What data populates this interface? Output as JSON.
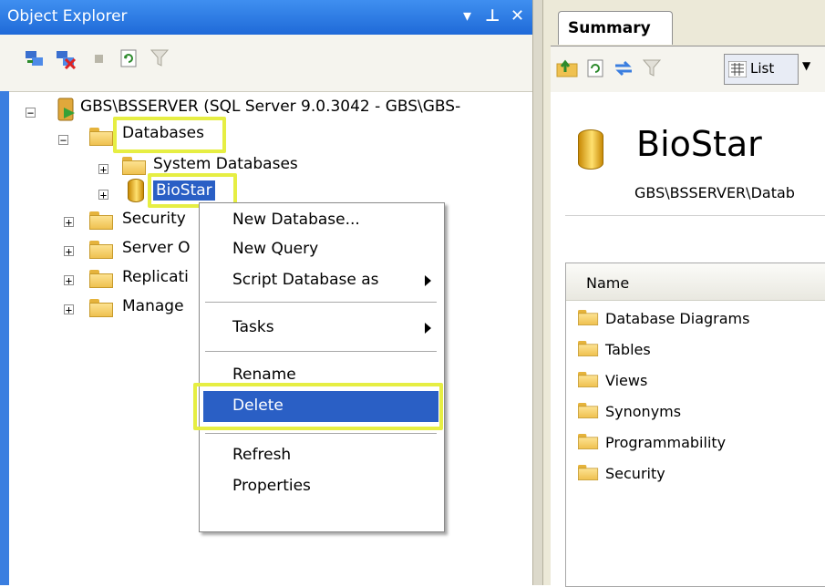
{
  "object_explorer": {
    "title": "Object Explorer",
    "controls": [
      "▾",
      "⊥",
      "✕"
    ],
    "tree": {
      "server": "GBS\\BSSERVER (SQL Server 9.0.3042 - GBS\\GBS-",
      "databases": "Databases",
      "system_databases": "System Databases",
      "biostar": "BioStar",
      "security": "Security",
      "server_objects": "Server O",
      "replication": "Replicati",
      "management": "Manage"
    }
  },
  "context_menu": {
    "items": {
      "new_database": "New Database...",
      "new_query": "New Query",
      "script_database_as": "Script Database as",
      "tasks": "Tasks",
      "rename": "Rename",
      "delete": "Delete",
      "refresh": "Refresh",
      "properties": "Properties"
    }
  },
  "summary": {
    "tab_label": "Summary",
    "view_button": "List",
    "db_title": "BioStar",
    "db_path": "GBS\\BSSERVER\\Datab",
    "list_header": "Name",
    "list_items": [
      "Database Diagrams",
      "Tables",
      "Views",
      "Synonyms",
      "Programmability",
      "Security"
    ]
  },
  "colors": {
    "titlebar": "#1f6ad8",
    "highlight_box": "#e6ee43",
    "selection": "#2a5fc5"
  }
}
